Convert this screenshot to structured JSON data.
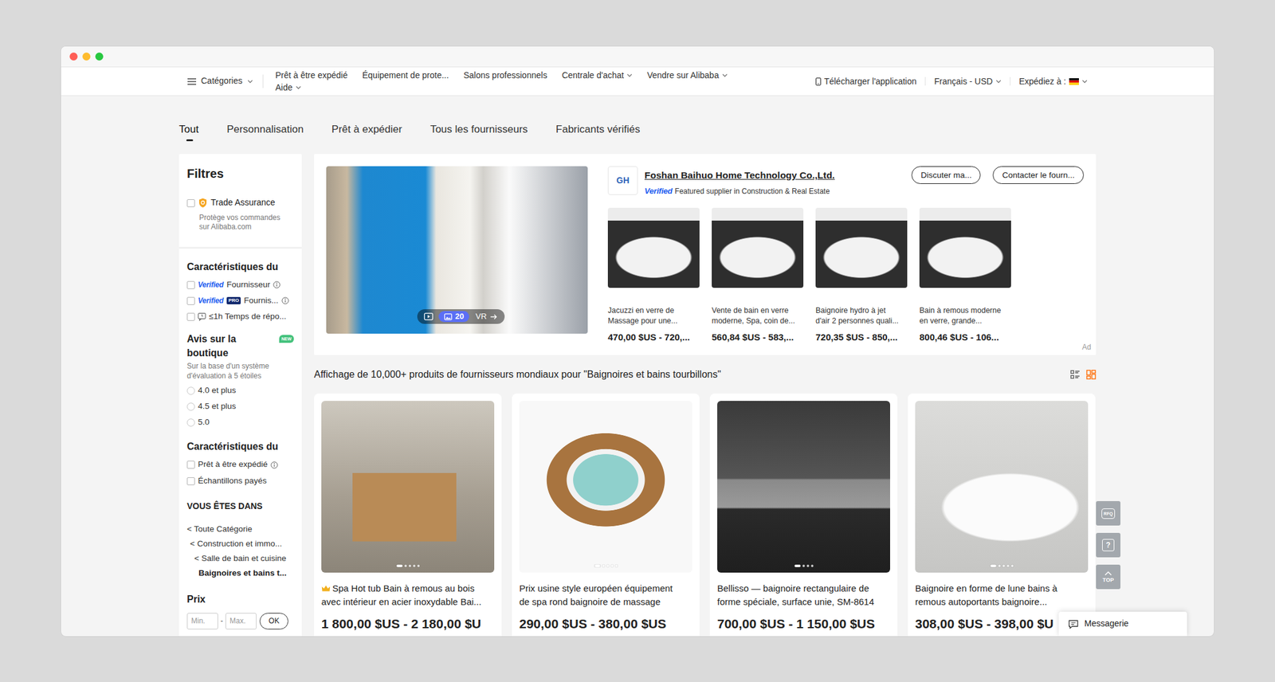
{
  "window": {
    "traffic_lights": [
      {
        "color": "#ff5f57"
      },
      {
        "color": "#febc2e"
      },
      {
        "color": "#28c840"
      }
    ]
  },
  "top_nav": {
    "categories": {
      "label": "Catégories",
      "dropdown": true
    },
    "items": [
      {
        "label": "Prêt à être expédié",
        "dropdown": false
      },
      {
        "label": "Équipement de prote...",
        "dropdown": false
      },
      {
        "label": "Salons professionnels",
        "dropdown": false
      },
      {
        "label": "Centrale d'achat",
        "dropdown": true
      },
      {
        "label": "Vendre sur Alibaba",
        "dropdown": true
      },
      {
        "label": "Aide",
        "dropdown": true
      }
    ],
    "app": {
      "label": "Télécharger l'application"
    },
    "language": {
      "label": "Français - USD",
      "dropdown": true
    },
    "ship_to": {
      "label": "Expédiez à :",
      "dropdown": true
    }
  },
  "tabs": [
    {
      "label": "Tout",
      "selected": true
    },
    {
      "label": "Personnalisation",
      "selected": false
    },
    {
      "label": "Prêt à expédier",
      "selected": false
    },
    {
      "label": "Tous les fournisseurs",
      "selected": false
    },
    {
      "label": "Fabricants vérifiés",
      "selected": false
    }
  ],
  "filters": {
    "title": "Filtres",
    "trade_assurance": {
      "label": "Trade Assurance",
      "checked": false,
      "description_lines": [
        "Protège vos commandes",
        "sur Alibaba.com"
      ]
    },
    "supplier_features": {
      "title": "Caractéristiques du",
      "items": [
        {
          "kind": "verified",
          "badge": "Verified",
          "label": "Fournisseur",
          "checked": false,
          "info": true
        },
        {
          "kind": "verified-pro",
          "badge": "Verified",
          "tag": "PRO",
          "label": "Fournis...",
          "checked": false,
          "info": true
        },
        {
          "kind": "response",
          "label": "≤1h Temps de répo...",
          "checked": false,
          "info": false
        }
      ]
    },
    "store_rating": {
      "title_lines": [
        "Avis sur la",
        "boutique"
      ],
      "badge": "NEW",
      "description_lines": [
        "Sur la base d'un système",
        "d'évaluation à 5 étoiles"
      ],
      "options": [
        {
          "label": "4.0 et plus",
          "selected": false
        },
        {
          "label": "4.5 et plus",
          "selected": false
        },
        {
          "label": "5.0",
          "selected": false
        }
      ]
    },
    "product_features": {
      "title": "Caractéristiques du",
      "items": [
        {
          "label": "Prêt à être expédié",
          "checked": false,
          "info": true
        },
        {
          "label": "Échantillons payés",
          "checked": false,
          "info": false
        }
      ]
    },
    "breadcrumb": {
      "title": "VOUS ÊTES DANS",
      "items": [
        {
          "label": "< Toute Catégorie",
          "current": false
        },
        {
          "label": "< Construction et immo...",
          "current": false
        },
        {
          "label": "< Salle de bain et cuisine",
          "current": false
        },
        {
          "label": "Baignoires et bains t...",
          "current": true
        }
      ]
    },
    "price": {
      "title": "Prix",
      "min_placeholder": "Min.",
      "separator": "-",
      "max_placeholder": "Max.",
      "button": "OK"
    }
  },
  "ad": {
    "media": {
      "photo_count": "20",
      "vr": "VR"
    },
    "supplier": {
      "logo": "GH",
      "name": "Foshan Baihuo Home Technology Co.,Ltd.",
      "verified": "Verified",
      "featured": "Featured supplier in Construction & Real Estate"
    },
    "buttons": [
      "Discuter ma...",
      "Contacter le fourn..."
    ],
    "products": [
      {
        "title_lines": [
          "Jacuzzi en verre de",
          "Massage pour une..."
        ],
        "price": "470,00 $US - 720,..."
      },
      {
        "title_lines": [
          "Vente de bain en verre",
          "moderne, Spa, coin de..."
        ],
        "price": "560,84 $US - 583,..."
      },
      {
        "title_lines": [
          "Baignoire hydro à jet",
          "d'air 2 personnes quali..."
        ],
        "price": "720,35 $US - 850,..."
      },
      {
        "title_lines": [
          "Bain à remous moderne",
          "en verre, grande..."
        ],
        "price": "800,46 $US - 106..."
      }
    ],
    "label": "Ad"
  },
  "results": {
    "summary": "Affichage de 10,000+ produits de fournisseurs mondiaux pour \"Baignoires et bains tourbillons\"",
    "view_modes": [
      {
        "kind": "list",
        "selected": false
      },
      {
        "kind": "grid",
        "selected": true
      }
    ],
    "products": [
      {
        "title_lines": [
          "Spa Hot tub Bain à remous au bois",
          "avec intérieur en acier inoxydable Bai..."
        ],
        "crown": true,
        "price": "1 800,00 $US - 2 180,00 $U",
        "slides": [
          {
            "selected": true
          },
          {
            "selected": false
          },
          {
            "selected": false
          },
          {
            "selected": false
          },
          {
            "selected": false
          }
        ]
      },
      {
        "title_lines": [
          "Prix usine style européen équipement",
          "de spa rond baignoire de massage"
        ],
        "crown": false,
        "price": "290,00 $US - 380,00 $US",
        "slides": [
          {
            "selected": true
          },
          {
            "selected": false
          },
          {
            "selected": false
          },
          {
            "selected": false
          },
          {
            "selected": false
          }
        ]
      },
      {
        "title_lines": [
          "Bellisso — baignoire rectangulaire de",
          "forme spéciale, surface unie, SM-8614"
        ],
        "crown": false,
        "price": "700,00 $US - 1 150,00 $US",
        "slides": [
          {
            "selected": true
          },
          {
            "selected": false
          },
          {
            "selected": false
          },
          {
            "selected": false
          }
        ]
      },
      {
        "title_lines": [
          "Baignoire en forme de lune bains à",
          "remous autoportants baignoire..."
        ],
        "crown": false,
        "price": "308,00 $US - 398,00 $U",
        "slides": [
          {
            "selected": true
          },
          {
            "selected": false
          },
          {
            "selected": false
          },
          {
            "selected": false
          },
          {
            "selected": false
          }
        ]
      }
    ]
  },
  "floating": {
    "rfq": "RFQ",
    "help": "?",
    "top": "TOP",
    "messages": "Messagerie"
  }
}
